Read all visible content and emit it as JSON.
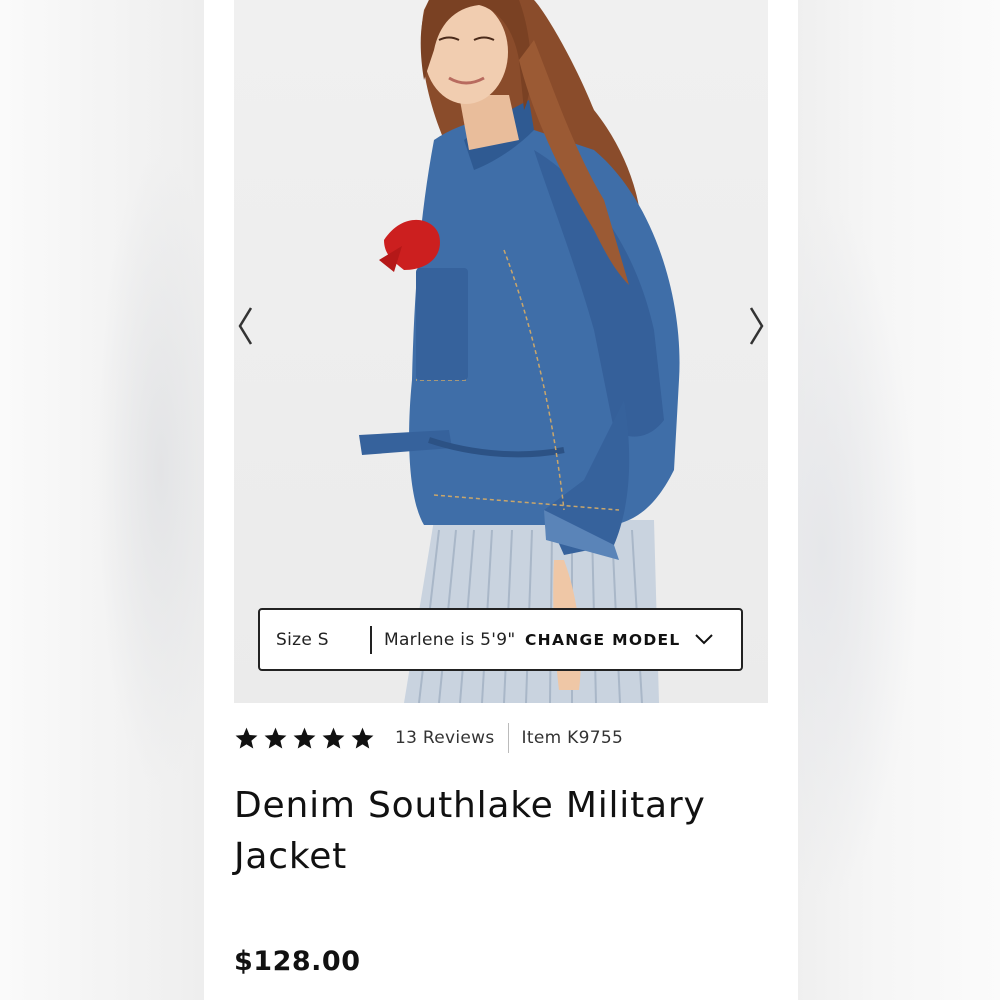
{
  "product": {
    "title": "Denim Southlake Military Jacket",
    "price": "$128.00",
    "rating": 5,
    "reviews_label": "13 Reviews",
    "item_label": "Item K9755"
  },
  "model_info": {
    "size_label": "Size S",
    "height_label": "Marlene is 5'9\"",
    "change_label": "CHANGE MODEL"
  },
  "icons": {
    "prev": "chevron-left-icon",
    "next": "chevron-right-icon",
    "dropdown": "chevron-down-icon",
    "star": "star-icon"
  },
  "colors": {
    "text": "#111111",
    "denim": "#3f6ea8",
    "bandana": "#cc1f1f"
  }
}
